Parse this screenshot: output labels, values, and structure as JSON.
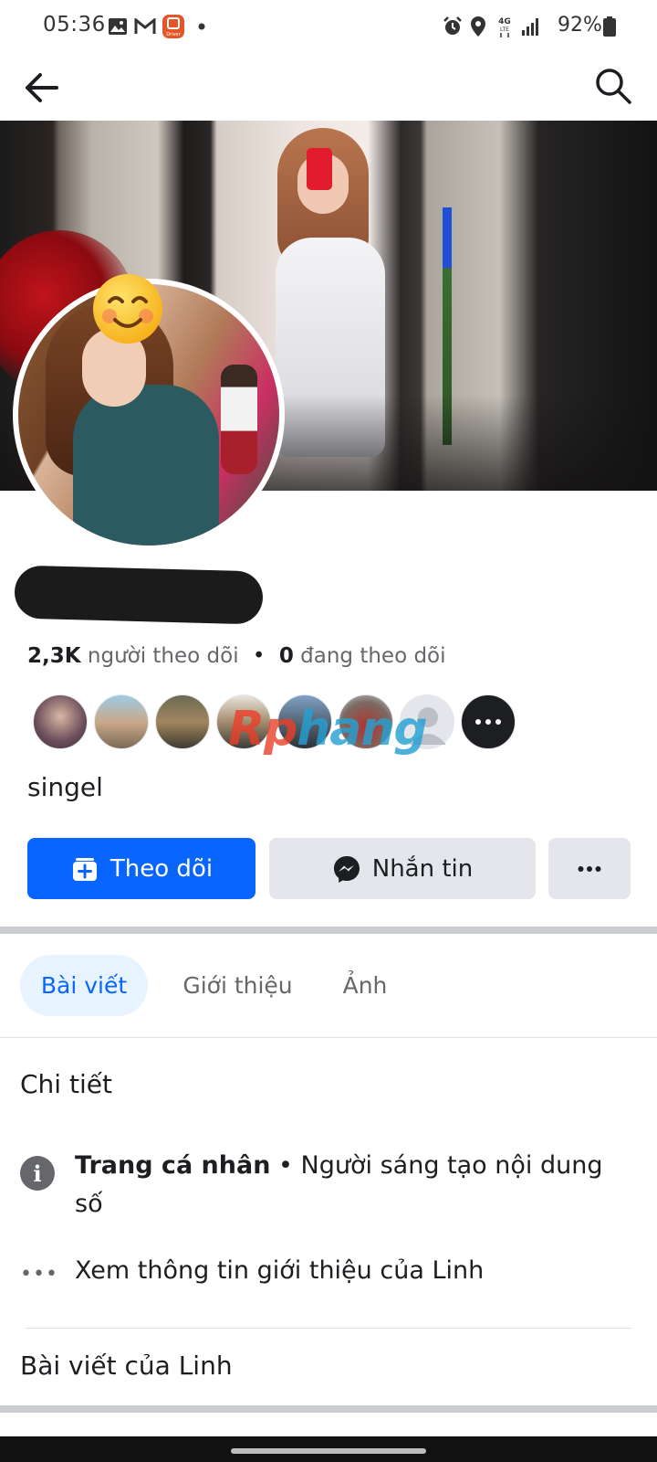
{
  "status_bar": {
    "time": "05:36",
    "battery": "92%",
    "network": "4G LTE",
    "icons": [
      "gallery-icon",
      "gmail-icon",
      "driver-app-icon",
      "notification-dot-icon",
      "alarm-icon",
      "location-icon",
      "signal-icon",
      "battery-icon"
    ],
    "driver_app_label": "Driver"
  },
  "top_nav": {
    "back_icon": "arrow-left-icon",
    "search_icon": "search-icon"
  },
  "profile": {
    "followers_count": "2,3K",
    "followers_label": "người theo dõi",
    "separator": "•",
    "following_count": "0",
    "following_label": "đang theo dõi",
    "bio": "singel",
    "watermark_part1": "Rp",
    "watermark_part2": "hang"
  },
  "actions": {
    "follow_label": "Theo dõi",
    "message_label": "Nhắn tin",
    "more_label": "···"
  },
  "tabs": [
    {
      "label": "Bài viết",
      "active": true
    },
    {
      "label": "Giới thiệu",
      "active": false
    },
    {
      "label": "Ảnh",
      "active": false
    }
  ],
  "details": {
    "title": "Chi tiết",
    "profile_type_bold": "Trang cá nhân",
    "profile_type_rest": " • Người sáng tạo nội dung số",
    "see_about": "Xem thông tin giới thiệu của Linh",
    "info_icon_glyph": "i",
    "dots_glyph": "•••"
  },
  "posts": {
    "title": "Bài viết của Linh"
  },
  "colors": {
    "accent": "#0866ff",
    "accent_light": "#e7f3ff",
    "secondary_button": "#e4e6eb",
    "muted_text": "#65676b"
  }
}
